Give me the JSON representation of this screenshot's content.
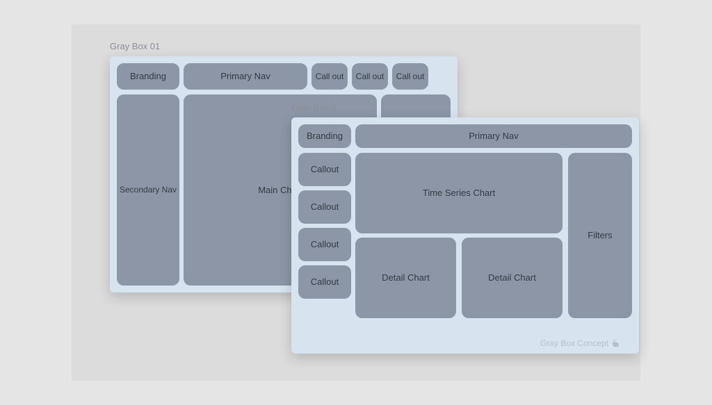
{
  "wireframe1": {
    "title": "Gray Box 01",
    "branding": "Branding",
    "primary_nav": "Primary Nav",
    "callouts": [
      "Call out",
      "Call out",
      "Call out"
    ],
    "secondary_nav": "Secondary Nav",
    "main_chart": "Main Chart"
  },
  "wireframe2": {
    "title": "Gray Box 2",
    "branding": "Branding",
    "primary_nav": "Primary Nav",
    "callouts": [
      "Callout",
      "Callout",
      "Callout",
      "Callout"
    ],
    "time_series": "Time Series Chart",
    "detail_chart_a": "Detail Chart",
    "detail_chart_b": "Detail Chart",
    "filters": "Filters",
    "footer": "Gray Box Concept"
  }
}
